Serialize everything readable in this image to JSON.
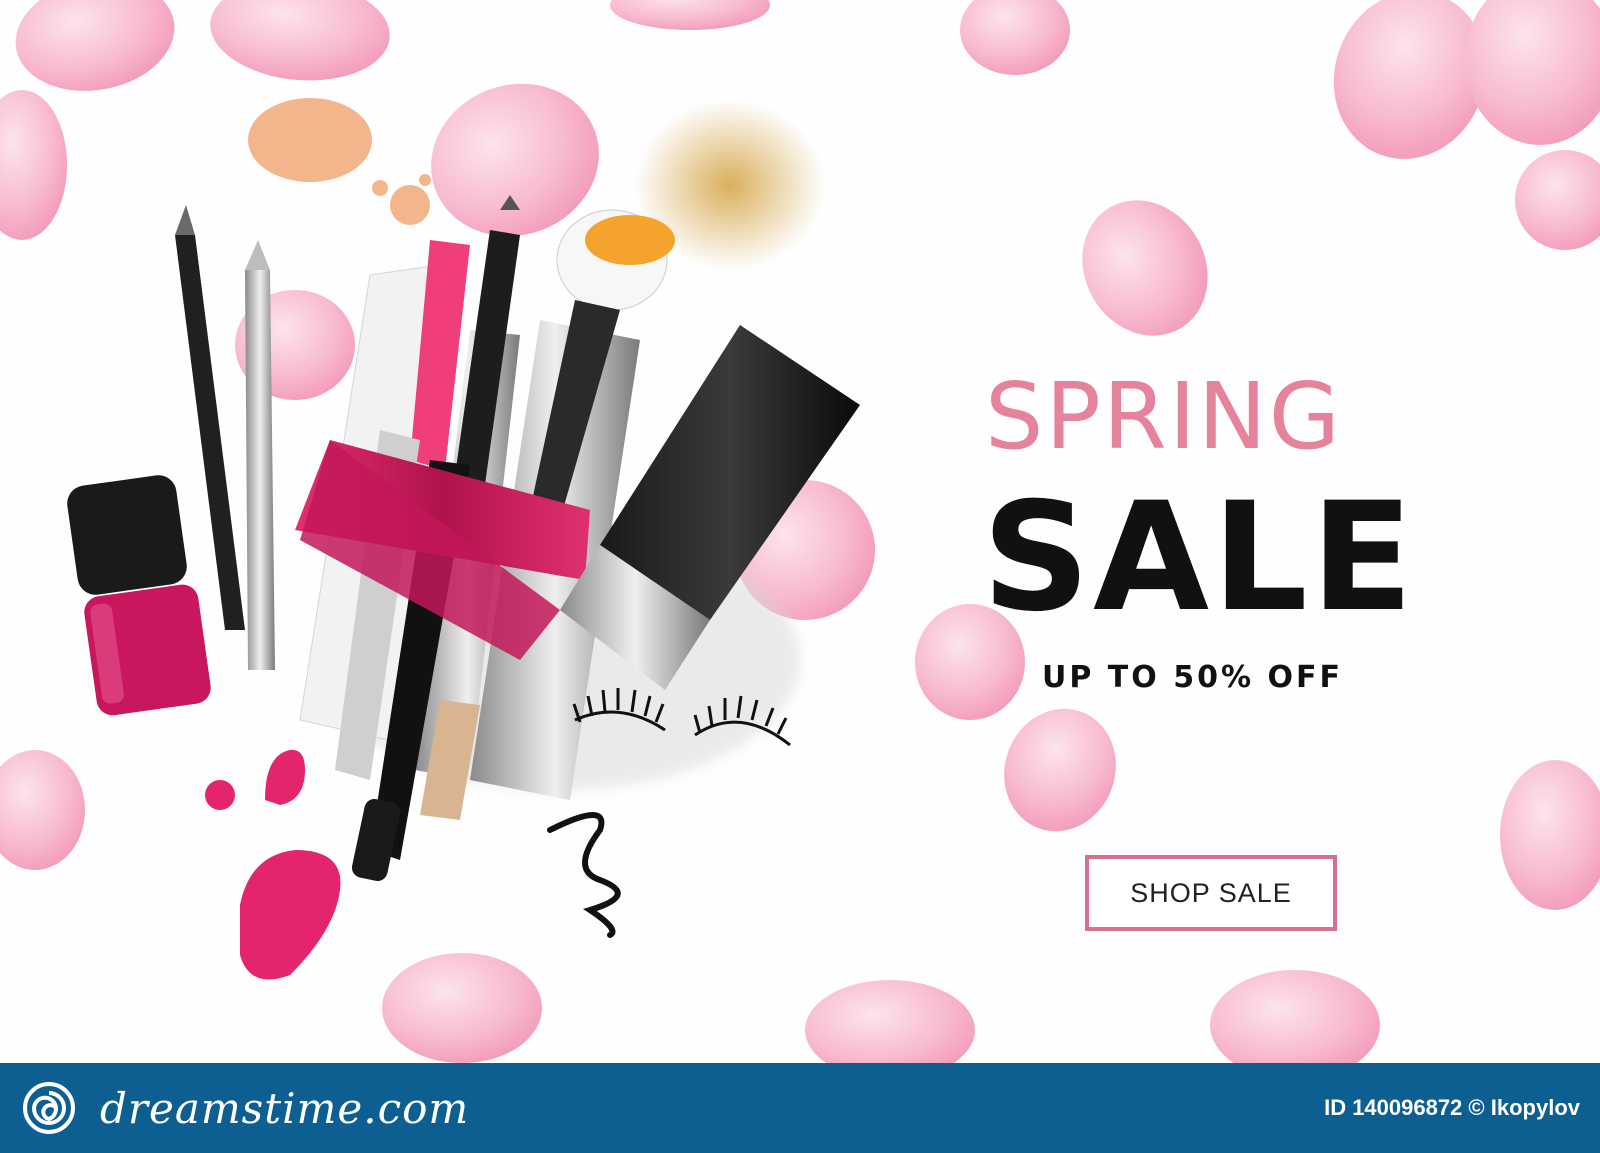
{
  "banner": {
    "headline": "SPRING",
    "headline_main": "SALE",
    "subline": "UP TO 50% OFF",
    "cta_label": "SHOP SALE"
  },
  "colors": {
    "headline": "#e4839b",
    "headline_main": "#111111",
    "subline": "#111111",
    "cta_border": "#d6708a",
    "cta_text": "#222222",
    "petal": "#f8bcd0",
    "ribbon": "#d81b60",
    "nail_polish": "#c8175e",
    "footer_bg": "#0d5f91"
  },
  "footer": {
    "logo_text": "dreamstime.com",
    "credit": "ID 140096872 © Ikopylov"
  },
  "icons": {
    "footer_logo": "dreamstime-swirl-icon"
  }
}
